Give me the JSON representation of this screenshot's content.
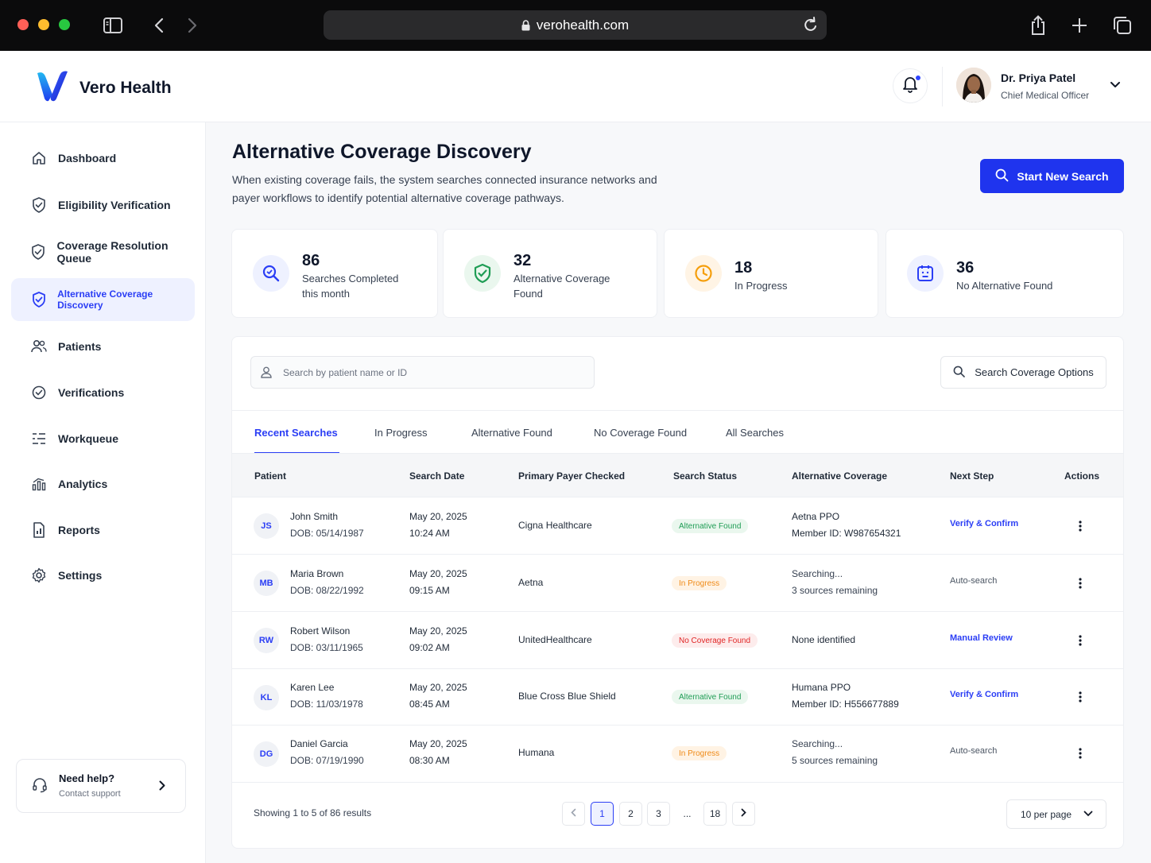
{
  "browser": {
    "url": "verohealth.com"
  },
  "app": {
    "name": "Vero Health"
  },
  "user": {
    "name": "Dr. Priya Patel",
    "role": "Chief Medical Officer"
  },
  "sidebar": {
    "items": [
      {
        "label": "Dashboard",
        "icon": "home-icon"
      },
      {
        "label": "Eligibility Verification",
        "icon": "shield-check-icon"
      },
      {
        "label": "Coverage Resolution Queue",
        "icon": "shield-check-icon"
      },
      {
        "label": "Alternative Coverage Discovery",
        "icon": "shield-check-icon",
        "active": true
      },
      {
        "label": "Patients",
        "icon": "users-icon"
      },
      {
        "label": "Verifications",
        "icon": "check-circle-icon"
      },
      {
        "label": "Workqueue",
        "icon": "list-icon"
      },
      {
        "label": "Analytics",
        "icon": "bar-chart-icon"
      },
      {
        "label": "Reports",
        "icon": "report-icon"
      },
      {
        "label": "Settings",
        "icon": "gear-icon"
      }
    ],
    "help": {
      "title": "Need help?",
      "subtitle": "Contact support"
    }
  },
  "page": {
    "title": "Alternative Coverage Discovery",
    "description": "When existing coverage fails, the system searches connected insurance networks and payer workflows to identify potential alternative coverage pathways.",
    "primary_button": "Start New Search"
  },
  "stats": [
    {
      "value": "86",
      "label": "Searches Completed this month",
      "color": "#2b3ef5"
    },
    {
      "value": "32",
      "label": "Alternative Coverage Found",
      "color": "#1f9d55"
    },
    {
      "value": "18",
      "label": "In Progress",
      "color": "#f59e0b"
    },
    {
      "value": "36",
      "label": "No Alternative Found",
      "color": "#2b3ef5"
    }
  ],
  "search": {
    "placeholder": "Search by patient name or ID",
    "coverage_button": "Search Coverage Options"
  },
  "tabs": [
    "Recent Searches",
    "In Progress",
    "Alternative Found",
    "No Coverage Found",
    "All Searches"
  ],
  "table": {
    "headers": [
      "Patient",
      "Search Date",
      "Primary Payer Checked",
      "Search Status",
      "Alternative Coverage",
      "Next Step",
      "Actions"
    ],
    "rows": [
      {
        "initials": "JS",
        "name": "John Smith",
        "dob": "DOB: 05/14/1987",
        "date": "May 20, 2025",
        "time": "10:24 AM",
        "payer": "Cigna Healthcare",
        "status": "Alternative Found",
        "alt1": "Aetna PPO",
        "alt2": "Member ID: W987654321",
        "next": "Verify & Confirm"
      },
      {
        "initials": "MB",
        "name": "Maria Brown",
        "dob": "DOB: 08/22/1992",
        "date": "May 20, 2025",
        "time": "09:15 AM",
        "payer": "Aetna",
        "status": "In Progress",
        "alt1": "Searching...",
        "alt2": "3 sources remaining",
        "next": "Auto-search"
      },
      {
        "initials": "RW",
        "name": "Robert Wilson",
        "dob": "DOB: 03/11/1965",
        "date": "May 20, 2025",
        "time": "09:02 AM",
        "payer": "UnitedHealthcare",
        "status": "No Coverage Found",
        "alt1": "None identified",
        "alt2": "",
        "next": "Manual Review"
      },
      {
        "initials": "KL",
        "name": "Karen Lee",
        "dob": "DOB: 11/03/1978",
        "date": "May 20, 2025",
        "time": "08:45 AM",
        "payer": "Blue Cross Blue Shield",
        "status": "Alternative Found",
        "alt1": "Humana PPO",
        "alt2": "Member ID: H556677889",
        "next": "Verify & Confirm"
      },
      {
        "initials": "DG",
        "name": "Daniel Garcia",
        "dob": "DOB: 07/19/1990",
        "date": "May 20, 2025",
        "time": "08:30 AM",
        "payer": "Humana",
        "status": "In Progress",
        "alt1": "Searching...",
        "alt2": "5 sources remaining",
        "next": "Auto-search"
      }
    ]
  },
  "pagination": {
    "summary": "Showing 1 to 5 of 86 results",
    "pages": [
      "1",
      "2",
      "3",
      "...",
      "18"
    ],
    "current": "1",
    "per_page": "10 per page"
  }
}
